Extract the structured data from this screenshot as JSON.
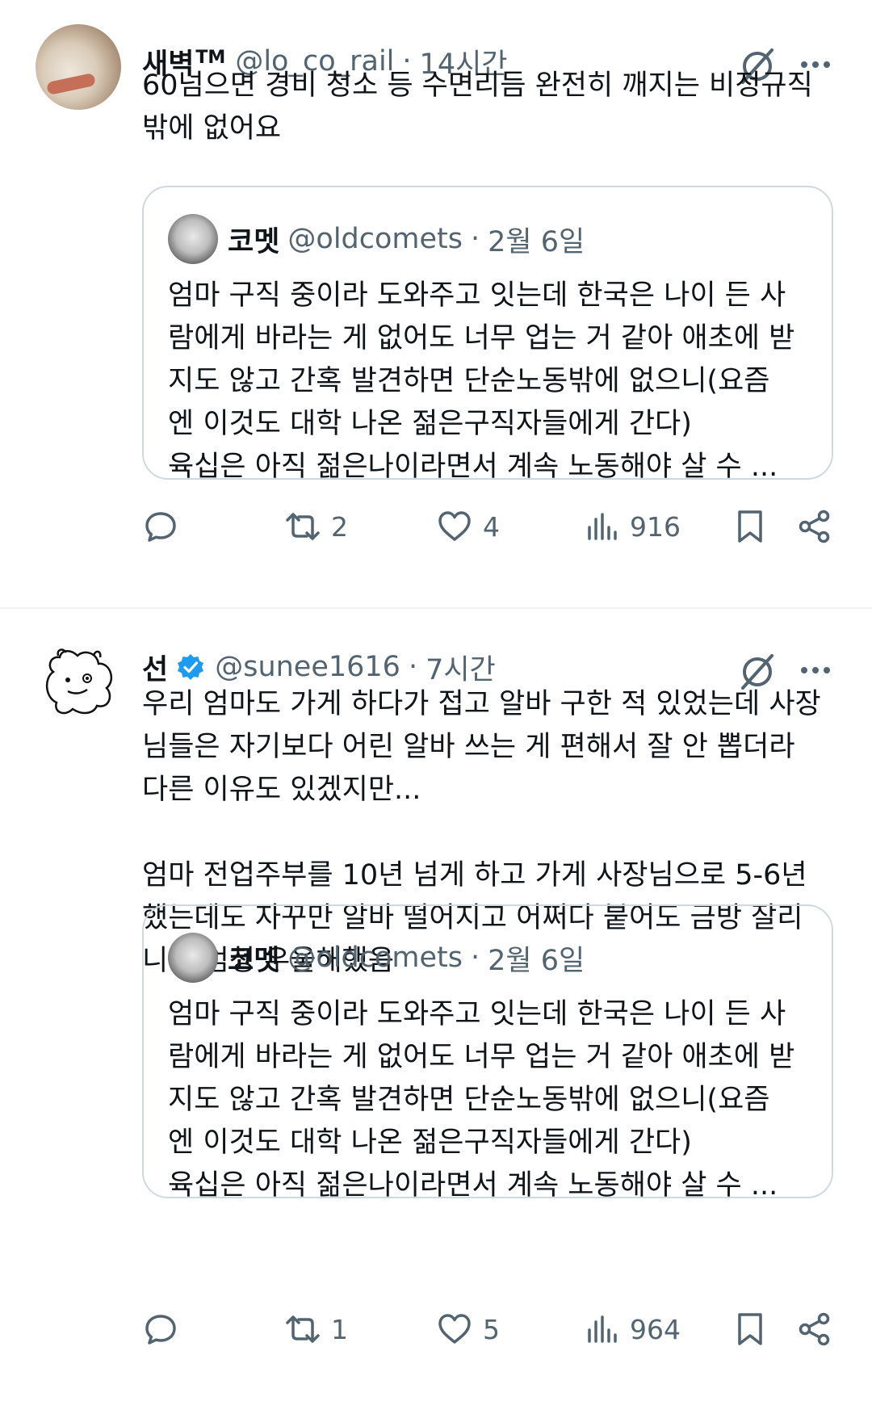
{
  "tweets": [
    {
      "name": "새벽",
      "tm": "TM",
      "handle": "@lo_co_rail",
      "separator": "·",
      "time": "14시간",
      "text": "60넘으면 경비 청소 등 수면리듬 완전히 깨지는 비정규직\n밖에 없어요",
      "quote": {
        "name": "코멧",
        "handle": "@oldcomets",
        "separator": "·",
        "date": "2월 6일",
        "lines": [
          "엄마 구직 중이라 도와주고 잇는데 한국은 나이 든 사",
          "람에게 바라는 게 없어도 너무 업는 거 같아 애초에 받",
          "지도 않고 간혹 발견하면 단순노동밖에 없으니(요즘",
          "엔 이것도 대학 나온 젊은구직자들에게 간다)",
          "육십은 아직 젊은나이라면서 계속 노동해야 살 수 ..."
        ]
      },
      "stats": {
        "replies": "",
        "reposts": "2",
        "likes": "4",
        "views": "916"
      }
    },
    {
      "name": "선",
      "handle": "@sunee1616",
      "separator": "·",
      "time": "7시간",
      "verified_color": "#1d9bf0",
      "paragraphs": [
        "우리 엄마도 가게 하다가 접고 알바 구한 적 있었는데 사장\n님들은 자기보다 어린 알바 쓰는 게 편해서 잘 안 뽑더라\n다른 이유도 있겠지만...",
        "엄마 전업주부를 10년 넘게 하고 가게 사장님으로 5-6년\n했는데도 자꾸만 알바 떨어지고 어쩌다 붙어도 금방 잘리\n니까 엄청 우울해했음"
      ],
      "quote": {
        "name": "코멧",
        "handle": "@oldcomets",
        "separator": "·",
        "date": "2월 6일",
        "lines": [
          "엄마 구직 중이라 도와주고 잇는데 한국은 나이 든 사",
          "람에게 바라는 게 없어도 너무 업는 거 같아 애초에 받",
          "지도 않고 간혹 발견하면 단순노동밖에 없으니(요즘",
          "엔 이것도 대학 나온 젊은구직자들에게 간다)",
          "육십은 아직 젊은나이라면서 계속 노동해야 살 수 ..."
        ]
      },
      "stats": {
        "replies": "",
        "reposts": "1",
        "likes": "5",
        "views": "964"
      }
    }
  ],
  "icons": {
    "grok": "grok-icon",
    "more": "more-icon",
    "reply": "reply-icon",
    "repost": "repost-icon",
    "like": "heart-icon",
    "views": "views-icon",
    "bookmark": "bookmark-icon",
    "share": "share-icon"
  },
  "colors": {
    "text": "#0f1419",
    "secondary": "#536471",
    "border": "#cfd9de",
    "verified": "#1d9bf0"
  }
}
